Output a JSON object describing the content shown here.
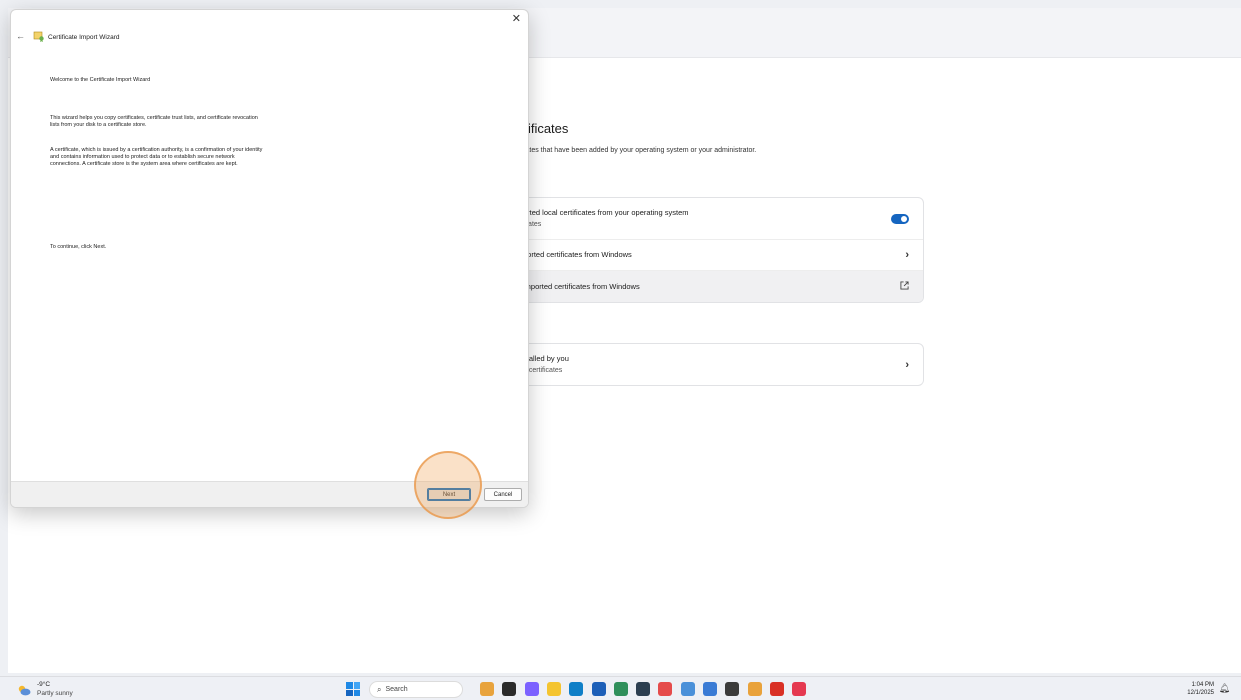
{
  "settings": {
    "title": "rtificates",
    "description": "cates that have been added by your operating system or your administrator.",
    "card1": {
      "rows": [
        {
          "label": "orted local certificates from your operating system",
          "sub": "icates"
        },
        {
          "label": "ported certificates from Windows"
        },
        {
          "label": "imported certificates from Windows"
        }
      ]
    },
    "card2": {
      "rows": [
        {
          "label": "stalled by you",
          "sub": "o certificates"
        }
      ]
    }
  },
  "wizard": {
    "title": "Certificate Import Wizard",
    "heading": "Welcome to the Certificate Import Wizard",
    "para1_line1": "This wizard helps you copy certificates, certificate trust lists, and certificate revocation",
    "para1_line2": "lists from your disk to a certificate store.",
    "para2_line1": "A certificate, which is issued by a certification authority, is a confirmation of your identity",
    "para2_line2": "and contains information used to protect data or to establish secure network",
    "para2_line3": "connections. A certificate store is the system area where certificates are kept.",
    "continue": "To continue, click Next.",
    "next_label": "Next",
    "cancel_label": "Cancel",
    "close_glyph": "✕",
    "back_glyph": "←"
  },
  "taskbar": {
    "weather_temp": "-9°C",
    "weather_cond": "Partly sunny",
    "search_placeholder": "Search",
    "time": "1:04 PM",
    "date": "12/1/2025",
    "apps": [
      {
        "name": "widgets-app-icon",
        "color": "#e8a33d"
      },
      {
        "name": "task-view-icon",
        "color": "#2b2b2b"
      },
      {
        "name": "copilot-icon",
        "color": "#7b61ff"
      },
      {
        "name": "file-explorer-icon",
        "color": "#f4c430"
      },
      {
        "name": "edge-icon",
        "color": "#0f7fc7"
      },
      {
        "name": "store-icon",
        "color": "#1d5fb8"
      },
      {
        "name": "app-icon-7",
        "color": "#2f8f5b"
      },
      {
        "name": "mail-icon",
        "color": "#2c3e50"
      },
      {
        "name": "app-icon-9",
        "color": "#e54b4b"
      },
      {
        "name": "notepad-icon",
        "color": "#4a90d9"
      },
      {
        "name": "network-app-icon",
        "color": "#3a7bd5"
      },
      {
        "name": "app-icon-12",
        "color": "#3b3b3b"
      },
      {
        "name": "chrome-icon",
        "color": "#e9a23b"
      },
      {
        "name": "app-icon-14",
        "color": "#d93025"
      },
      {
        "name": "app-icon-15",
        "color": "#e53950"
      }
    ]
  }
}
